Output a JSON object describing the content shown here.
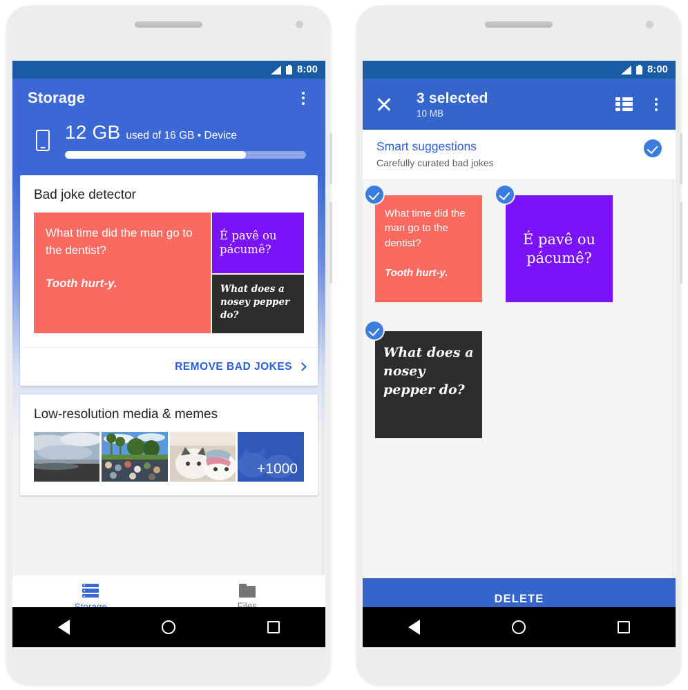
{
  "status_bar": {
    "time": "8:00",
    "signal_icon": "signal-triangle-icon",
    "battery_icon": "battery-icon"
  },
  "colors": {
    "primary_blue": "#3b68d4",
    "status_blue": "#1a5ba6",
    "selection_blue": "#3365cc",
    "link_blue": "#2b5fd9",
    "joke_red": "#fb6a61",
    "joke_purple": "#7a13f7",
    "joke_dark": "#2d2d2d",
    "check_blue": "#3b7ddd"
  },
  "left_phone": {
    "appbar": {
      "title": "Storage",
      "overflow_icon": "kebab-menu-icon"
    },
    "storage_summary": {
      "device_icon": "phone-device-icon",
      "used": "12 GB",
      "detail": "used of 16 GB • Device",
      "percent_used": 75
    },
    "cards": [
      {
        "title": "Bad joke detector",
        "tiles": [
          {
            "id": "joke-red",
            "question": "What time did the man go to the dentist?",
            "answer": "Tooth hurt-y.",
            "color": "#fb6a61"
          },
          {
            "id": "joke-purple",
            "text": "É pavê ou pácumê?",
            "color": "#7a13f7"
          },
          {
            "id": "joke-dark",
            "text": "What does a nosey pepper do?",
            "color": "#2d2d2d"
          }
        ],
        "action_label": "REMOVE BAD JOKES",
        "action_icon": "chevron-right-icon"
      },
      {
        "title": "Low-resolution media & memes",
        "thumbnails": [
          {
            "id": "thumb-beach",
            "alt": "beach-photo"
          },
          {
            "id": "thumb-crowd",
            "alt": "crowd-park-photo"
          },
          {
            "id": "thumb-cats",
            "alt": "two-cats-photo"
          },
          {
            "id": "thumb-more",
            "overlay_label": "+1000"
          }
        ]
      }
    ],
    "bottom_nav": [
      {
        "id": "storage",
        "label": "Storage",
        "icon": "storage-bars-icon",
        "active": true
      },
      {
        "id": "files",
        "label": "Files",
        "icon": "folder-icon",
        "active": false
      }
    ]
  },
  "right_phone": {
    "appbar": {
      "close_icon": "close-x-icon",
      "count": "3 selected",
      "size": "10 MB",
      "list_view_icon": "list-view-icon",
      "overflow_icon": "kebab-menu-icon"
    },
    "suggestions": {
      "title": "Smart suggestions",
      "subtitle": "Carefully curated bad jokes",
      "selected": true,
      "check_icon": "check-circle-icon"
    },
    "tiles": [
      {
        "id": "sel-joke-red",
        "question": "What time did the man go to the dentist?",
        "answer": "Tooth hurt-y.",
        "color": "#fb6a61",
        "selected": true
      },
      {
        "id": "sel-joke-purple",
        "text": "É pavê ou pácumê?",
        "color": "#7a13f7",
        "selected": true
      },
      {
        "id": "sel-joke-dark",
        "text": "What does a nosey pepper do?",
        "color": "#2d2d2d",
        "selected": true
      }
    ],
    "delete_label": "DELETE"
  },
  "android_navbar": {
    "back_icon": "back-triangle-icon",
    "home_icon": "home-circle-icon",
    "recents_icon": "recents-square-icon"
  }
}
